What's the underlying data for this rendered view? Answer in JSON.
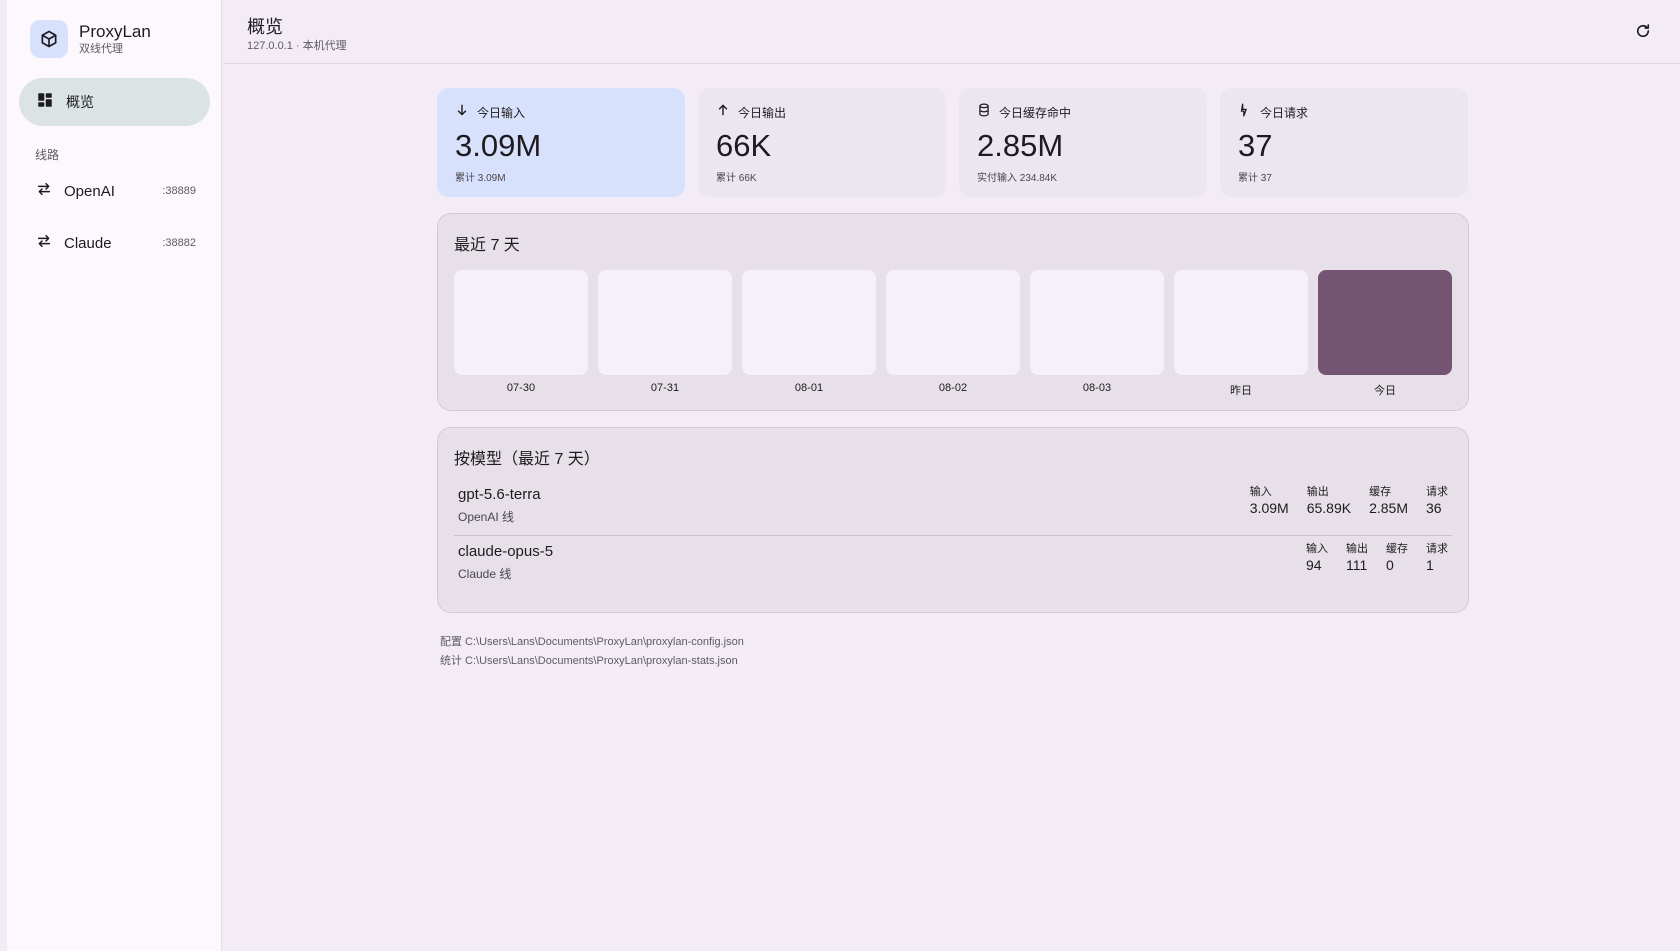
{
  "brand": {
    "name": "ProxyLan",
    "subtitle": "双线代理"
  },
  "nav": {
    "overview_label": "概览",
    "section_label": "线路"
  },
  "routes": [
    {
      "label": "OpenAI",
      "port": ":38889"
    },
    {
      "label": "Claude",
      "port": ":38882"
    }
  ],
  "header": {
    "title": "概览",
    "subtitle": "127.0.0.1 · 本机代理"
  },
  "stats": [
    {
      "title": "今日输入",
      "value": "3.09M",
      "foot": "累计 3.09M",
      "icon": "arrow-down-icon"
    },
    {
      "title": "今日输出",
      "value": "66K",
      "foot": "累计 66K",
      "icon": "arrow-up-icon"
    },
    {
      "title": "今日缓存命中",
      "value": "2.85M",
      "foot": "实付输入 234.84K",
      "icon": "database-icon"
    },
    {
      "title": "今日请求",
      "value": "37",
      "foot": "累计 37",
      "icon": "bolt-icon"
    }
  ],
  "recent": {
    "title": "最近 7 天",
    "days": [
      "07-30",
      "07-31",
      "08-01",
      "08-02",
      "08-03",
      "昨日",
      "今日"
    ]
  },
  "models": {
    "title": "按模型（最近 7 天）",
    "headers": {
      "input": "输入",
      "output": "输出",
      "cache": "缓存",
      "requests": "请求"
    },
    "rows": [
      {
        "name": "gpt-5.6-terra",
        "line": "OpenAI 线",
        "input": "3.09M",
        "output": "65.89K",
        "cache": "2.85M",
        "requests": "36"
      },
      {
        "name": "claude-opus-5",
        "line": "Claude 线",
        "input": "94",
        "output": "111",
        "cache": "0",
        "requests": "1"
      }
    ]
  },
  "paths": {
    "config": "配置 C:\\Users\\Lans\\Documents\\ProxyLan\\proxylan-config.json",
    "stats": "统计 C:\\Users\\Lans\\Documents\\ProxyLan\\proxylan-stats.json"
  },
  "colors": {
    "accent_card": "#d8e1fb",
    "today_bar": "#735573",
    "active_nav": "#dbe3e4"
  }
}
